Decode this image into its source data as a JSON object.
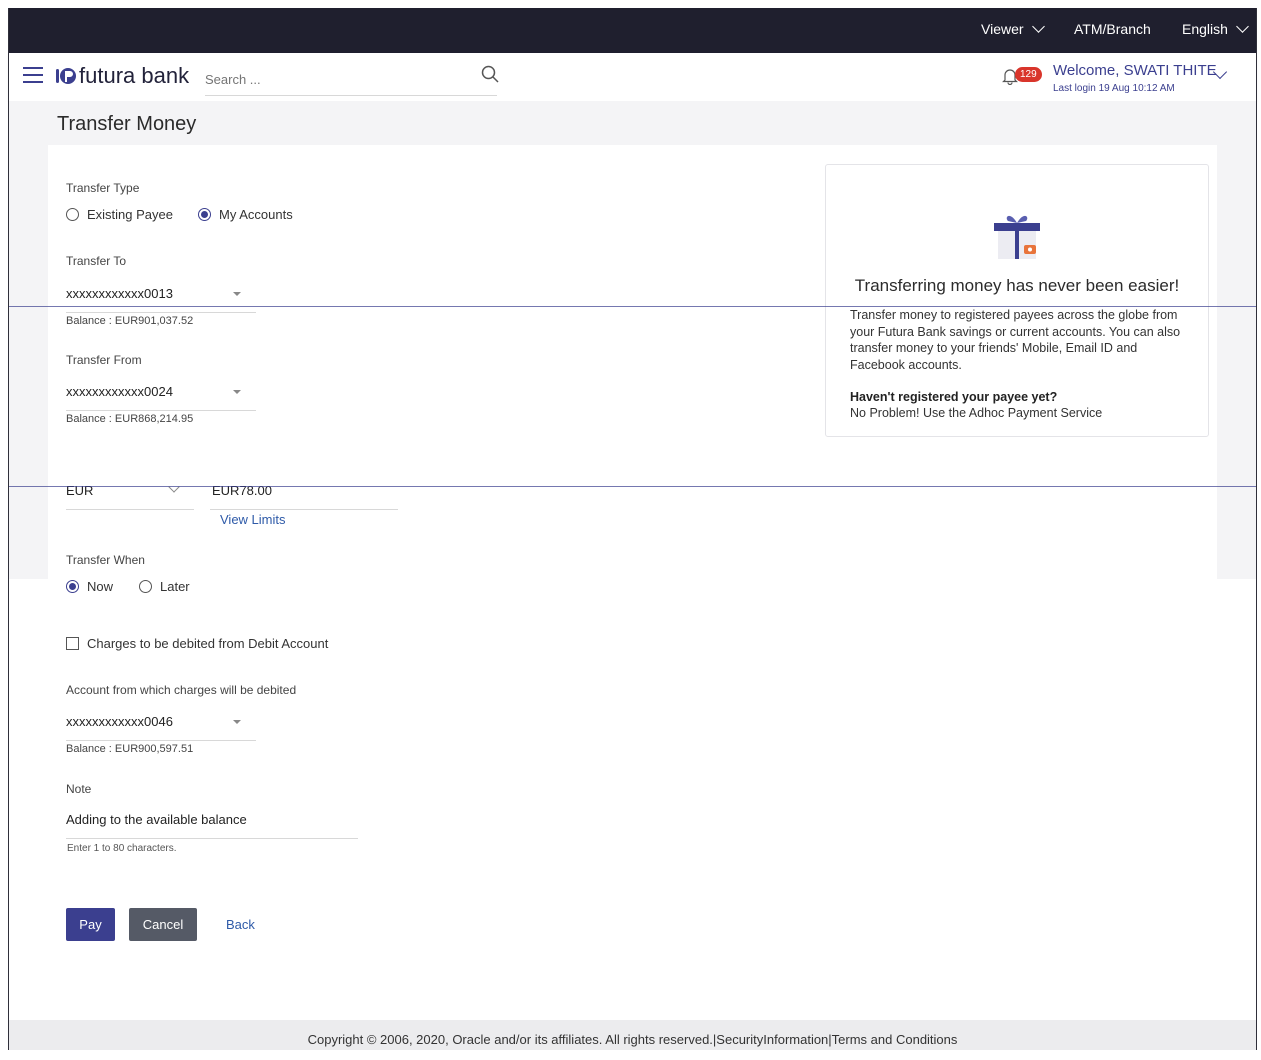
{
  "topbar": {
    "viewer": "Viewer",
    "atm_branch": "ATM/Branch",
    "language": "English"
  },
  "header": {
    "brand": "futura bank",
    "search_placeholder": "Search ...",
    "notification_count": "129",
    "welcome": "Welcome, SWATI THITE",
    "last_login": "Last login 19 Aug 10:12 AM"
  },
  "page": {
    "title": "Transfer Money"
  },
  "form": {
    "transfer_type_label": "Transfer Type",
    "transfer_type_options": [
      "Existing Payee",
      "My Accounts"
    ],
    "transfer_type_selected": "My Accounts",
    "transfer_to_label": "Transfer To",
    "transfer_to_value": "xxxxxxxxxxxx0013",
    "transfer_to_balance": "Balance : EUR901,037.52",
    "transfer_from_label": "Transfer From",
    "transfer_from_value": "xxxxxxxxxxxx0024",
    "transfer_from_balance": "Balance : EUR868,214.95",
    "currency": "EUR",
    "amount": "EUR78.00",
    "view_limits": "View Limits",
    "transfer_when_label": "Transfer When",
    "transfer_when_options": [
      "Now",
      "Later"
    ],
    "transfer_when_selected": "Now",
    "charges_checkbox_label": "Charges to be debited from Debit Account",
    "charges_checked": false,
    "charges_account_label": "Account from which charges will be debited",
    "charges_account_value": "xxxxxxxxxxxx0046",
    "charges_account_balance": "Balance : EUR900,597.51",
    "note_label": "Note",
    "note_value": "Adding to the available balance",
    "note_hint": "Enter 1 to 80 characters.",
    "pay_label": "Pay",
    "cancel_label": "Cancel",
    "back_label": "Back"
  },
  "info": {
    "title": "Transferring money has never been easier!",
    "body": "Transfer money to registered payees across the globe from your Futura Bank savings or current accounts. You can also transfer money to your friends' Mobile, Email ID and Facebook accounts.",
    "question": "Haven't registered your payee yet?",
    "answer": "No Problem! Use the Adhoc Payment Service"
  },
  "footer": {
    "text": "Copyright © 2006, 2020, Oracle and/or its affiliates. All rights reserved.|SecurityInformation|Terms and Conditions"
  },
  "colors": {
    "primary": "#3b3f8f",
    "topbar": "#1f1f2e",
    "badge": "#d9352b",
    "link": "#2e5aa8"
  }
}
